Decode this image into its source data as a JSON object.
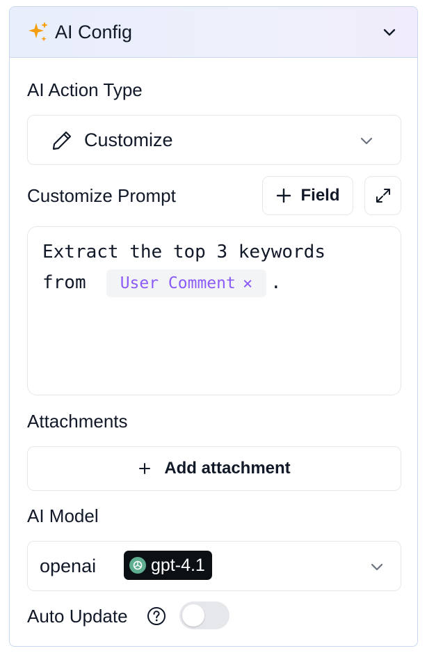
{
  "header": {
    "title": "AI Config",
    "sparkle_icon": "sparkles-icon",
    "collapse_icon": "chevron-down-icon"
  },
  "action_type": {
    "label": "AI Action Type",
    "value": "Customize",
    "icon": "pencil-icon"
  },
  "prompt": {
    "label": "Customize Prompt",
    "field_button": "Field",
    "line1": "Extract the top 3 keywords",
    "line2_prefix": "from",
    "chip_label": "User Comment",
    "chip_remove": "×",
    "line2_suffix": "."
  },
  "attachments": {
    "label": "Attachments",
    "button": "Add attachment"
  },
  "model": {
    "label": "AI Model",
    "provider": "openai",
    "name": "gpt-4.1"
  },
  "auto_update": {
    "label": "Auto Update",
    "enabled": false
  },
  "colors": {
    "accent_purple": "#8b5cf6",
    "header_border": "#c7d7f0",
    "openai_green": "#5fae91"
  }
}
